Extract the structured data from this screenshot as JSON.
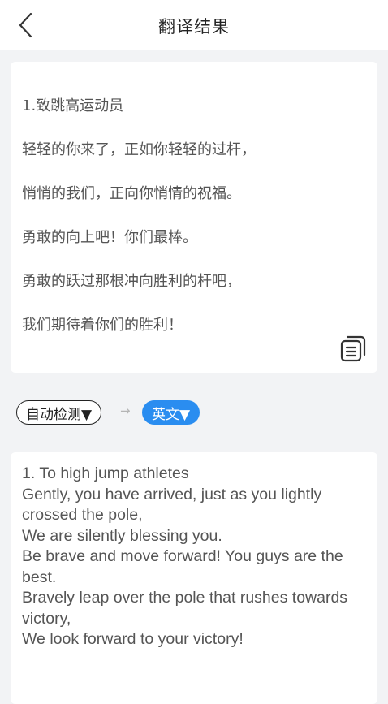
{
  "header": {
    "title": "翻译结果"
  },
  "source": {
    "lines": [
      "1.致跳高运动员",
      "轻轻的你来了，正如你轻轻的过杆，",
      "悄悄的我们，正向你悄情的祝福。",
      "勇敢的向上吧！你们最棒。",
      "勇敢的跃过那根冲向胜利的杆吧，",
      "我们期待着你们的胜利！"
    ]
  },
  "languages": {
    "source_label": "自动检测▼",
    "arrow": "→",
    "target_label": "英文▼"
  },
  "result": {
    "lines": [
      "1. To high jump athletes",
      "Gently, you have arrived, just as you lightly crossed the pole,",
      "We are silently blessing you.",
      "Be brave and move forward! You guys are the best.",
      "Bravely leap over the pole that rushes towards victory,",
      "We look forward to your victory!"
    ]
  },
  "icons": {
    "back": "chevron-left-icon",
    "copy": "copy-icon"
  },
  "colors": {
    "accent": "#2a8df0",
    "background": "#f2f3f5"
  }
}
